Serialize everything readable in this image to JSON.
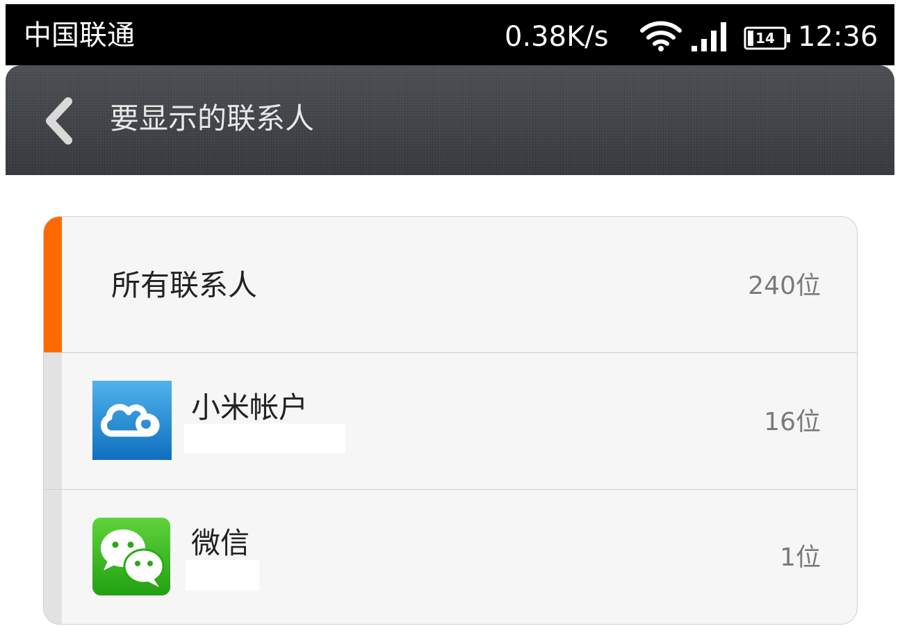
{
  "status_bar": {
    "carrier": "中国联通",
    "net_speed": "0.38K/s",
    "battery_level": "14",
    "time": "12:36",
    "wifi_icon": "wifi-icon",
    "signal_icon": "signal-icon",
    "battery_icon": "battery-icon"
  },
  "action_bar": {
    "back_icon": "chevron-left-icon",
    "title": "要显示的联系人"
  },
  "accounts": [
    {
      "label": "所有联系人",
      "count": "240位",
      "accent_color": "#ff6a00"
    },
    {
      "label": "小米帐户",
      "account_name": "",
      "count": "16位",
      "icon": "mi-cloud-icon",
      "accent_color": "#e2e2e2"
    },
    {
      "label": "微信",
      "account_name": "",
      "count": "1位",
      "icon": "wechat-icon",
      "accent_color": "#e2e2e2"
    }
  ],
  "colors": {
    "status_bar_bg": "#000000",
    "action_bar_bg": "#3a3d42",
    "selected_accent": "#ff6a00",
    "card_bg": "#f6f6f6",
    "mi_cloud_blue": "#1e8fd8",
    "wechat_green": "#3dbb1e"
  }
}
